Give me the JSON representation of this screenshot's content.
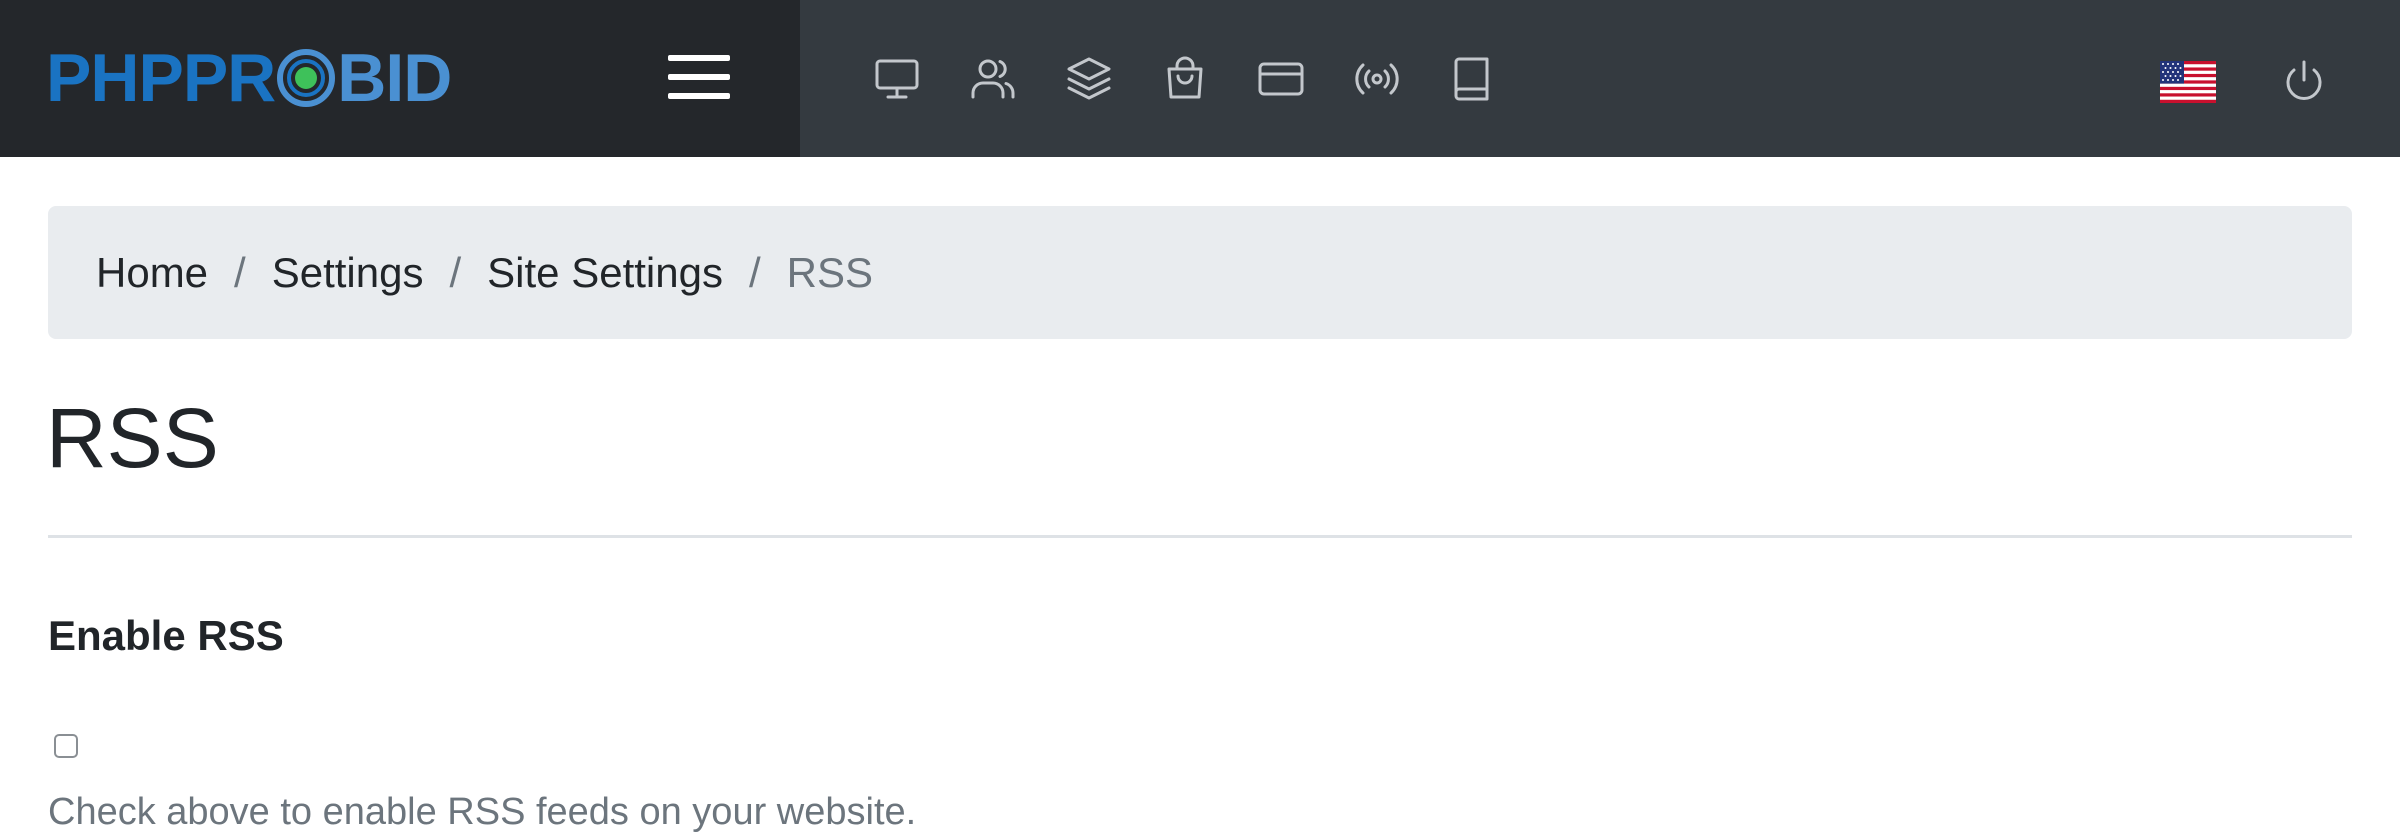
{
  "brand": {
    "name_part1": "PHPPR",
    "name_part2": "BID",
    "colors": {
      "dark_blue": "#1a73c2",
      "light_blue": "#4a90d2",
      "green": "#3ec15a"
    }
  },
  "navbar": {
    "menu_icon": "hamburger-icon",
    "icons": [
      "desktop-icon",
      "users-icon",
      "layers-icon",
      "shopping-bag-icon",
      "credit-card-icon",
      "broadcast-icon",
      "book-icon"
    ],
    "language_flag": "us-flag-icon",
    "logout_icon": "power-icon"
  },
  "breadcrumb": {
    "items": [
      "Home",
      "Settings",
      "Site Settings"
    ],
    "active": "RSS",
    "separator": "/"
  },
  "page": {
    "title": "RSS"
  },
  "form": {
    "enable_rss_label": "Enable RSS",
    "enable_rss_checked": false,
    "enable_rss_help": "Check above to enable RSS feeds on your website."
  },
  "colors": {
    "navbar_bg": "#343a40",
    "brand_bg": "#24272b",
    "breadcrumb_bg": "#e9ecef",
    "muted_text": "#6c757d"
  }
}
